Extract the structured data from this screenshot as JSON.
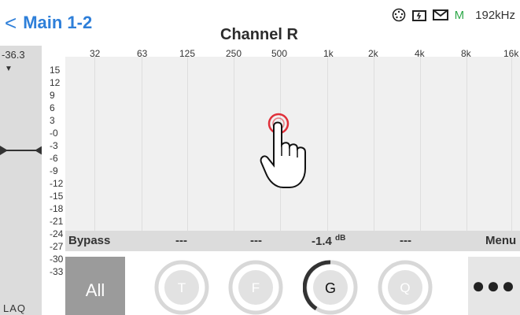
{
  "header": {
    "back_label": "Main 1-2",
    "title": "Channel R",
    "status": {
      "icons": [
        "midi-connector-icon",
        "folder-sync-icon",
        "mail-icon"
      ],
      "mode_letter": "M",
      "sample_rate": "192kHz"
    }
  },
  "level": {
    "value": "-36.3",
    "peak_marker": "▼",
    "footer_label": "LAQ"
  },
  "db_scale": [
    "15",
    "12",
    "9",
    "6",
    "3",
    "-0",
    "-3",
    "-6",
    "-9",
    "-12",
    "-15",
    "-18",
    "-21",
    "-24",
    "-27",
    "-30",
    "-33"
  ],
  "freq_scale": [
    "32",
    "63",
    "125",
    "250",
    "500",
    "1k",
    "2k",
    "4k",
    "8k",
    "16k"
  ],
  "bar": {
    "bypass": "Bypass",
    "slot2": "---",
    "slot3": "---",
    "gain_value": "-1.4",
    "gain_unit": "dB",
    "slot5": "---",
    "menu": "Menu"
  },
  "controls": {
    "all_label": "All",
    "knobs": [
      "T",
      "F",
      "G",
      "Q"
    ],
    "selected_knob": "G",
    "menu_dots": "●●●"
  },
  "colors": {
    "accent": "#2e7fd9",
    "mode_green": "#2fa84a",
    "touch_red": "#e0303a"
  }
}
